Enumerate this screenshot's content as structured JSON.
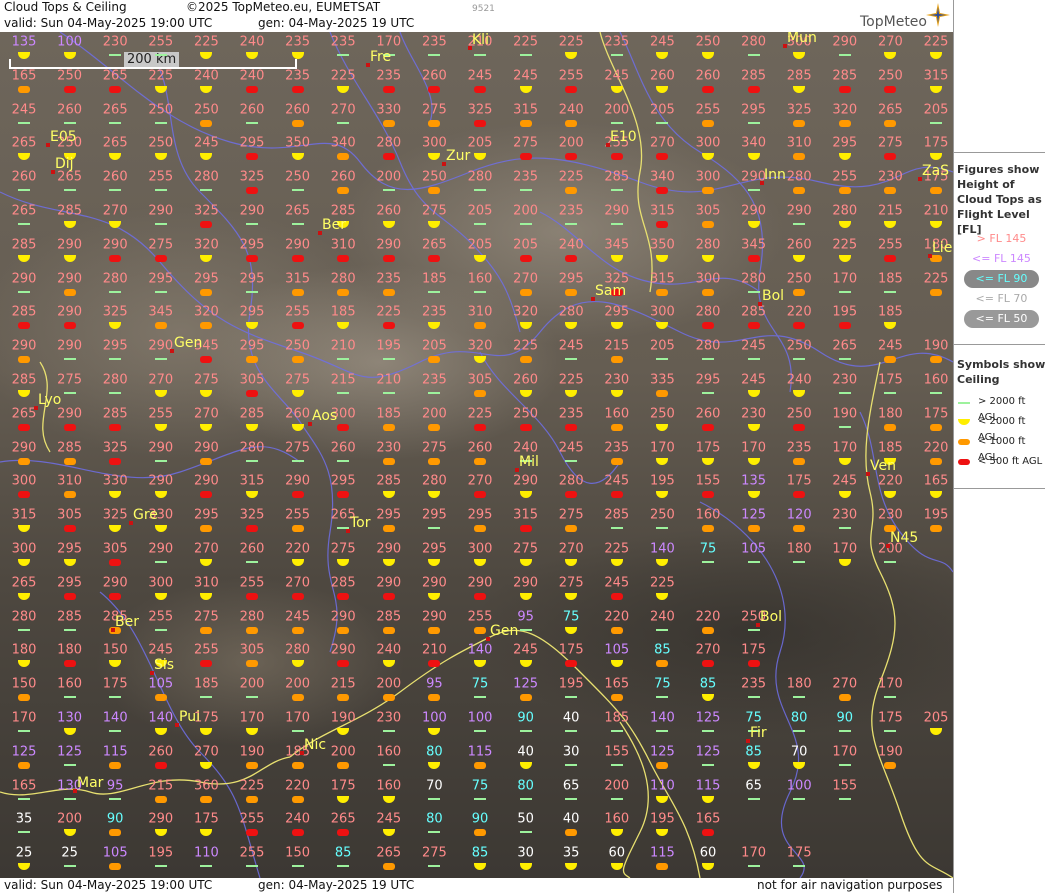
{
  "header": {
    "title": "Cloud Tops & Ceiling",
    "copyright": "©2025 TopMeteo.eu, EUMETSAT",
    "valid": "valid:  Sun  04-May-2025  19:00 UTC",
    "gen": "gen: 04-May-2025 19 UTC",
    "small_id": "9521",
    "logo": "TopMeteo"
  },
  "footer": {
    "valid": "valid:  Sun  04-May-2025  19:00 UTC",
    "gen": "gen: 04-May-2025 19 UTC",
    "disclaimer": "not for air navigation purposes"
  },
  "scale_label": "200 km",
  "legend": {
    "fig_title": "Figures show Height of Cloud Tops as Flight Level  [FL]",
    "fl": [
      {
        "text": "> FL 145",
        "color": "#ff8a8a",
        "bg": ""
      },
      {
        "text": "<= FL 145",
        "color": "#cc88ff",
        "bg": ""
      },
      {
        "text": "<= FL 90",
        "color": "#66ffff",
        "bg": "#888888"
      },
      {
        "text": "<= FL 70",
        "color": "#aaaaaa",
        "bg": ""
      },
      {
        "text": "<= FL 50",
        "color": "#ffffff",
        "bg": "#999999"
      }
    ],
    "sym_title": "Symbols show Ceiling",
    "sym": [
      {
        "text": "> 2000 ft AGL",
        "type": "green"
      },
      {
        "text": "< 2000 ft AGL",
        "type": "yellow"
      },
      {
        "text": "< 1000 ft AGL",
        "type": "orange"
      },
      {
        "text": "< 500 ft AGL",
        "type": "red"
      }
    ]
  },
  "colors": {
    "hi": "#ff8a8a",
    "mid": "#cc88ff",
    "low": "#66ffff",
    "vlow": "#ffffff",
    "ceil_green": "#9df29d",
    "ceil_yellow": "#ffee00",
    "ceil_orange": "#ff9900",
    "ceil_red": "#ee1111",
    "city": "#ffff66",
    "coast": "#e8e070",
    "border": "#6f6fe8"
  },
  "grid": {
    "rows": [
      [
        "135",
        "100",
        "230",
        "255",
        "225",
        "240",
        "235",
        "235",
        "170",
        "235",
        "210",
        "225",
        "225",
        "235",
        "245",
        "250",
        "280",
        "300",
        "290",
        "270",
        "225"
      ],
      [
        "165",
        "250",
        "265",
        "225",
        "240",
        "240",
        "235",
        "225",
        "235",
        "260",
        "245",
        "245",
        "255",
        "245",
        "260",
        "260",
        "285",
        "285",
        "285",
        "250",
        "315"
      ],
      [
        "245",
        "260",
        "265",
        "250",
        "250",
        "260",
        "260",
        "270",
        "330",
        "275",
        "325",
        "315",
        "240",
        "200",
        "205",
        "255",
        "295",
        "325",
        "320",
        "265",
        "205"
      ],
      [
        "265",
        "250",
        "265",
        "250",
        "245",
        "295",
        "350",
        "340",
        "280",
        "300",
        "205",
        "275",
        "200",
        "255",
        "270",
        "300",
        "340",
        "310",
        "295",
        "275",
        "175",
        "240"
      ],
      [
        "260",
        "265",
        "260",
        "255",
        "280",
        "325",
        "250",
        "260",
        "200",
        "250",
        "280",
        "235",
        "225",
        "285",
        "340",
        "300",
        "290",
        "280",
        "255",
        "230",
        "175",
        "265"
      ],
      [
        "265",
        "285",
        "270",
        "290",
        "325",
        "290",
        "265",
        "285",
        "260",
        "275",
        "205",
        "200",
        "235",
        "290",
        "315",
        "305",
        "290",
        "290",
        "280",
        "215",
        "210"
      ],
      [
        "285",
        "290",
        "290",
        "275",
        "320",
        "295",
        "290",
        "310",
        "290",
        "265",
        "205",
        "205",
        "240",
        "345",
        "350",
        "280",
        "345",
        "260",
        "225",
        "255",
        "180",
        "230"
      ],
      [
        "290",
        "290",
        "280",
        "295",
        "295",
        "295",
        "315",
        "280",
        "235",
        "185",
        "160",
        "270",
        "295",
        "325",
        "315",
        "300",
        "280",
        "250",
        "170",
        "185",
        "225"
      ],
      [
        "285",
        "290",
        "325",
        "345",
        "320",
        "295",
        "255",
        "185",
        "225",
        "235",
        "310",
        "320",
        "280",
        "295",
        "300",
        "280",
        "285",
        "220",
        "195",
        "185"
      ],
      [
        "290",
        "290",
        "295",
        "290",
        "345",
        "295",
        "250",
        "210",
        "195",
        "205",
        "320",
        "225",
        "245",
        "215",
        "205",
        "280",
        "245",
        "250",
        "265",
        "245",
        "190"
      ],
      [
        "285",
        "275",
        "280",
        "270",
        "275",
        "305",
        "275",
        "215",
        "210",
        "235",
        "305",
        "260",
        "225",
        "230",
        "335",
        "295",
        "245",
        "240",
        "230",
        "175",
        "160"
      ],
      [
        "265",
        "290",
        "285",
        "255",
        "270",
        "285",
        "260",
        "300",
        "185",
        "200",
        "225",
        "250",
        "235",
        "160",
        "250",
        "260",
        "230",
        "250",
        "190",
        "180",
        "175"
      ],
      [
        "290",
        "285",
        "325",
        "290",
        "290",
        "280",
        "275",
        "260",
        "230",
        "275",
        "260",
        "240",
        "245",
        "235",
        "170",
        "175",
        "170",
        "235",
        "170",
        "185",
        "220"
      ],
      [
        "300",
        "310",
        "330",
        "290",
        "290",
        "315",
        "290",
        "295",
        "285",
        "280",
        "270",
        "290",
        "280",
        "245",
        "195",
        "155",
        "135",
        "175",
        "245",
        "220",
        "165"
      ],
      [
        "315",
        "305",
        "325",
        "330",
        "295",
        "325",
        "255",
        "265",
        "295",
        "295",
        "295",
        "315",
        "275",
        "285",
        "250",
        "160",
        "125",
        "120",
        "230",
        "230",
        "195"
      ],
      [
        "300",
        "295",
        "305",
        "290",
        "270",
        "260",
        "220",
        "275",
        "290",
        "295",
        "300",
        "275",
        "270",
        "225",
        "140",
        "75",
        "105",
        "180",
        "170",
        "200"
      ],
      [
        "265",
        "295",
        "290",
        "300",
        "310",
        "255",
        "270",
        "285",
        "290",
        "290",
        "290",
        "290",
        "275",
        "245",
        "225"
      ],
      [
        "280",
        "285",
        "285",
        "255",
        "275",
        "280",
        "245",
        "290",
        "285",
        "290",
        "255",
        "95",
        "75",
        "220",
        "240",
        "220",
        "250"
      ],
      [
        "180",
        "180",
        "150",
        "245",
        "255",
        "305",
        "280",
        "290",
        "240",
        "210",
        "140",
        "245",
        "175",
        "105",
        "85",
        "270",
        "175"
      ],
      [
        "150",
        "160",
        "175",
        "105",
        "185",
        "200",
        "200",
        "215",
        "200",
        "95",
        "75",
        "125",
        "195",
        "165",
        "75",
        "85",
        "235",
        "180",
        "270",
        "170"
      ],
      [
        "170",
        "130",
        "140",
        "140",
        "175",
        "170",
        "170",
        "190",
        "230",
        "100",
        "100",
        "90",
        "40",
        "185",
        "140",
        "125",
        "75",
        "80",
        "90",
        "175",
        "205"
      ],
      [
        "125",
        "125",
        "115",
        "260",
        "270",
        "190",
        "185",
        "200",
        "160",
        "80",
        "115",
        "40",
        "30",
        "155",
        "125",
        "125",
        "85",
        "70",
        "170",
        "190"
      ],
      [
        "165",
        "130",
        "95",
        "215",
        "360",
        "225",
        "220",
        "175",
        "160",
        "70",
        "75",
        "80",
        "65",
        "200",
        "110",
        "115",
        "65",
        "100",
        "155"
      ],
      [
        "35",
        "200",
        "90",
        "290",
        "175",
        "255",
        "240",
        "265",
        "245",
        "80",
        "90",
        "50",
        "40",
        "160",
        "195",
        "165"
      ],
      [
        "25",
        "25",
        "105",
        "195",
        "110",
        "255",
        "150",
        "85",
        "265",
        "275",
        "85",
        "30",
        "35",
        "60",
        "115",
        "60",
        "170",
        "175"
      ]
    ]
  },
  "cities": [
    "Kli",
    "Mun",
    "Fre",
    "E05",
    "E10",
    "Zur",
    "Dij",
    "Inn",
    "ZaS",
    "Ber",
    "Lie",
    "Sam",
    "Bol",
    "Gen",
    "Lyo",
    "Aos",
    "Mil",
    "Ven",
    "Gre",
    "Tor",
    "N45",
    "Ber",
    "Bol",
    "Gen",
    "Sis",
    "Pui",
    "Nic",
    "Fir",
    "Mar"
  ]
}
